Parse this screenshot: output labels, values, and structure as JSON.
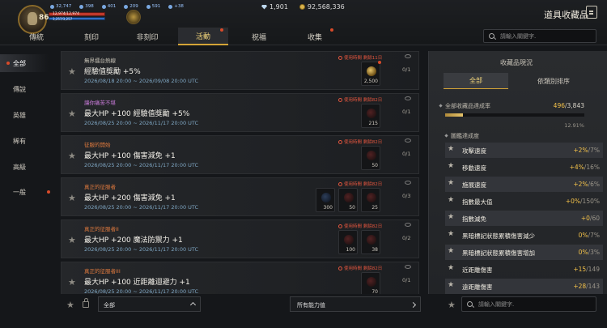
{
  "player": {
    "level": "86",
    "stat1": "32,747",
    "stat2": "398",
    "stat3": "401",
    "stat4": "209",
    "stat5": "591",
    "stat6": "+38",
    "hp": "12,974/12,974",
    "mp": "3,257/3,257"
  },
  "currency": {
    "diamond": "1,901",
    "gold": "92,568,336"
  },
  "title": "道具收藏品",
  "tabs": [
    "傳統",
    "刻印",
    "非刻印",
    "活動",
    "祝福",
    "收集"
  ],
  "active_tab": "活動",
  "search_placeholder": "請輸入關鍵字.",
  "sidebar": [
    "全部",
    "傳說",
    "英雄",
    "稀有",
    "高級",
    "一般"
  ],
  "cards": [
    {
      "category": "無界擂台熱線",
      "cat_color": "#c9c4b8",
      "name": "經驗值獎勵 +5%",
      "dates": "2026/08/18 20:00 ~ 2026/09/08 20:00 UTC",
      "limit": "使用時間 剩餘11日",
      "progress": "0/1",
      "slots": [
        {
          "cnt": "2,500",
          "type": "gold",
          "dot": true
        }
      ]
    },
    {
      "category": "讓你痛苦不堪",
      "cat_color": "#c77ad8",
      "name": "最大HP +100 經驗值獎勵 +5%",
      "dates": "2026/08/25 20:00 ~ 2026/11/17 20:00 UTC",
      "limit": "使用時間 剩餘82日",
      "progress": "0/1",
      "slots": [
        {
          "cnt": "215",
          "type": "red"
        }
      ]
    },
    {
      "category": "征服的開始",
      "cat_color": "#e07a3e",
      "name": "最大HP +100 傷害減免 +1",
      "dates": "2026/08/25 20:00 ~ 2026/11/17 20:00 UTC",
      "limit": "使用時間 剩餘82日",
      "progress": "0/1",
      "slots": [
        {
          "cnt": "50",
          "type": "red"
        }
      ]
    },
    {
      "category": "真正的征服者",
      "cat_color": "#e07a3e",
      "name": "最大HP +200 傷害減免 +1",
      "dates": "2026/08/25 20:00 ~ 2026/11/17 20:00 UTC",
      "limit": "使用時間 剩餘82日",
      "progress": "0/3",
      "slots": [
        {
          "cnt": "300",
          "type": "blue"
        },
        {
          "cnt": "50",
          "type": "red"
        },
        {
          "cnt": "25",
          "type": "red"
        }
      ]
    },
    {
      "category": "真正的征服者II",
      "cat_color": "#e07a3e",
      "name": "最大HP +200 魔法防禦力 +1",
      "dates": "2026/08/25 20:00 ~ 2026/11/17 20:00 UTC",
      "limit": "使用時間 剩餘82日",
      "progress": "0/2",
      "slots": [
        {
          "cnt": "100",
          "type": "red"
        },
        {
          "cnt": "38",
          "type": "red"
        }
      ]
    },
    {
      "category": "真正的征服者III",
      "cat_color": "#e07a3e",
      "name": "最大HP +100 近距離迴避力 +1",
      "dates": "2026/08/25 20:00 ~ 2026/11/17 20:00 UTC",
      "limit": "使用時間 剩餘82日",
      "progress": "0/1",
      "slots": [
        {
          "cnt": "70",
          "type": "red"
        }
      ]
    }
  ],
  "bottom": {
    "filter": "全部",
    "ability": "所有能力值"
  },
  "panel": {
    "title": "收藏品現況",
    "tab_all": "全部",
    "tab_sort": "依類別排序",
    "rate_label": "全部收藏品達成率",
    "rate_current": "496",
    "rate_total": "/3,843",
    "rate_fraction": 0.129,
    "rate_pct": "12.91%",
    "section": "圖鑑達成度",
    "attrs": [
      {
        "name": "攻擊速度",
        "cur": "+2%",
        "max": "/7%"
      },
      {
        "name": "移動速度",
        "cur": "+4%",
        "max": "/16%"
      },
      {
        "name": "施展速度",
        "cur": "+2%",
        "max": "/6%"
      },
      {
        "name": "指數最大值",
        "cur": "+0%",
        "max": "/150%"
      },
      {
        "name": "指數減免",
        "cur": "+0",
        "max": "/60"
      },
      {
        "name": "黑暗標記狀態累積傷害減少",
        "cur": "0%",
        "max": "/7%"
      },
      {
        "name": "黑暗標記狀態累積傷害增加",
        "cur": "0%",
        "max": "/3%"
      },
      {
        "name": "近距離傷害",
        "cur": "+15",
        "max": "/149"
      },
      {
        "name": "遠距離傷害",
        "cur": "+28",
        "max": "/143"
      }
    ]
  }
}
